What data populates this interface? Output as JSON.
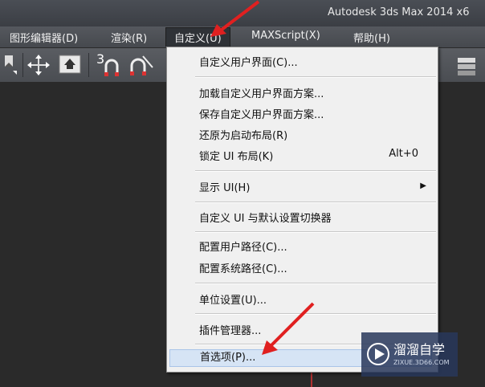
{
  "window": {
    "title": "Autodesk 3ds Max  2014 x6"
  },
  "menubar": {
    "items": [
      {
        "label": "图形编辑器(D)"
      },
      {
        "label": "渲染(R)"
      },
      {
        "label": "自定义(U)"
      },
      {
        "label": "MAXScript(X)"
      },
      {
        "label": "帮助(H)"
      }
    ]
  },
  "toolbar": {
    "number_label": "3"
  },
  "customize_menu": {
    "items": [
      {
        "label": "自定义用户界面(C)..."
      },
      {
        "label": "加载自定义用户界面方案..."
      },
      {
        "label": "保存自定义用户界面方案..."
      },
      {
        "label": "还原为启动布局(R)"
      },
      {
        "label": "锁定 UI 布局(K)",
        "shortcut": "Alt+0"
      },
      {
        "label": "显示 UI(H)",
        "submenu": true
      },
      {
        "label": "自定义 UI 与默认设置切换器"
      },
      {
        "label": "配置用户路径(C)..."
      },
      {
        "label": "配置系统路径(C)..."
      },
      {
        "label": "单位设置(U)..."
      },
      {
        "label": "插件管理器..."
      },
      {
        "label": "首选项(P)...",
        "highlighted": true
      }
    ]
  },
  "watermark": {
    "text": "溜溜自学",
    "url": "ZIXUE.3D66.COM"
  },
  "colors": {
    "arrow": "#e02020",
    "highlight": "#d6e4f5"
  }
}
